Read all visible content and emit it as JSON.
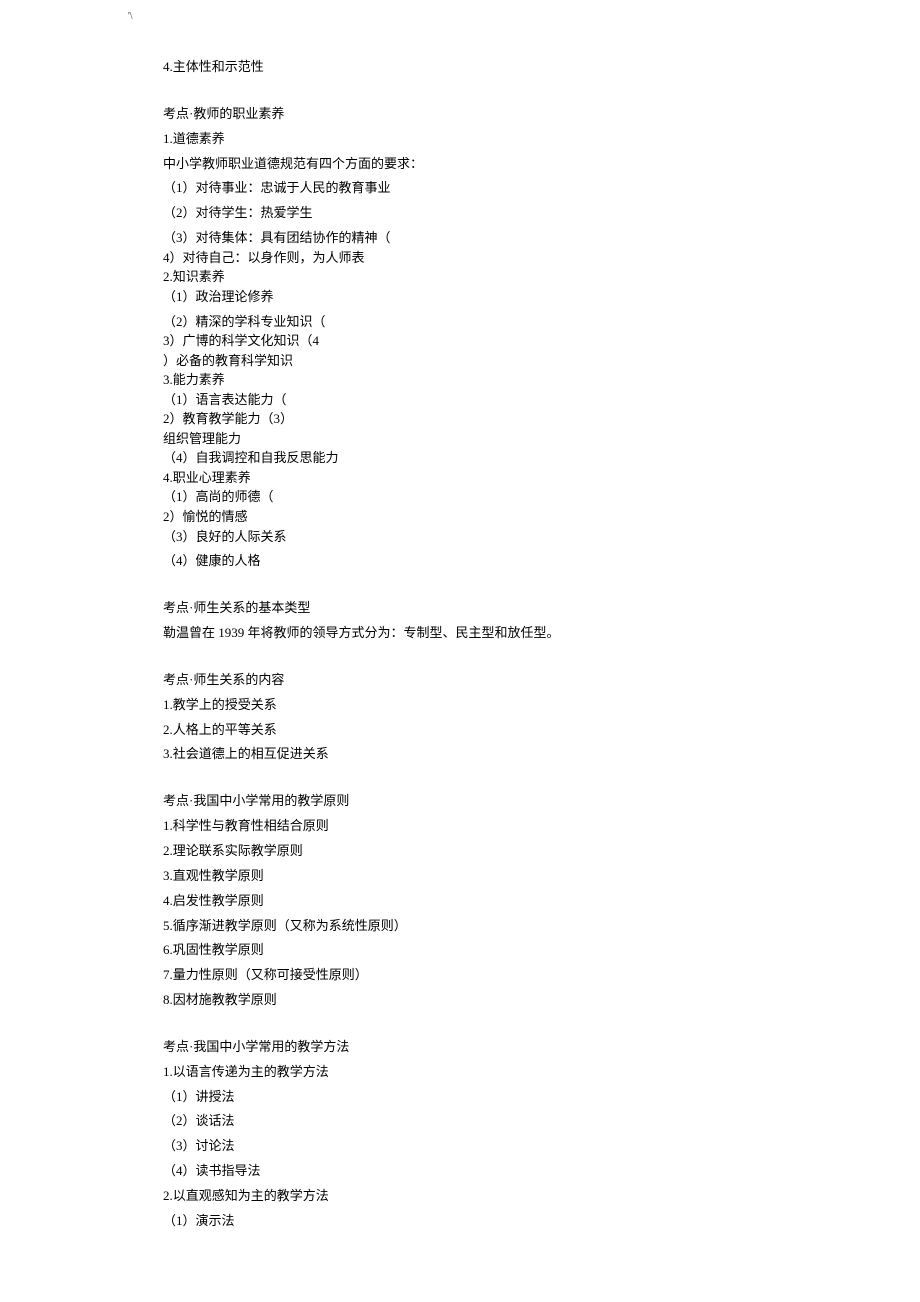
{
  "corner_mark": "'\\",
  "lines": {
    "l01": "4.主体性和示范性",
    "l02": "考点·教师的职业素养",
    "l03": "1.道德素养",
    "l04": "中小学教师职业道德规范有四个方面的要求：",
    "l05": "（1）对待事业：忠诚于人民的教育事业",
    "l06": "（2）对待学生：热爱学生",
    "l07": "（3）对待集体：具有团结协作的精神（",
    "l08": "4）对待自己：以身作则，为人师表",
    "l09": "2.知识素养",
    "l10": "（1）政治理论修养",
    "l11": "（2）精深的学科专业知识（",
    "l12": "3）广博的科学文化知识（4",
    "l13": "）必备的教育科学知识",
    "l14": "3.能力素养",
    "l15": "（1）语言表达能力（",
    "l16": "2）教育教学能力（3）",
    "l17": "组织管理能力",
    "l18": "（4）自我调控和自我反思能力",
    "l19": "4.职业心理素养",
    "l20": "（1）高尚的师德（",
    "l21": "2）愉悦的情感",
    "l22": "（3）良好的人际关系",
    "l23": "（4）健康的人格",
    "l24": "考点·师生关系的基本类型",
    "l25": "勒温曾在 1939 年将教师的领导方式分为：专制型、民主型和放任型。",
    "l26": "考点·师生关系的内容",
    "l27": "1.教学上的授受关系",
    "l28": "2.人格上的平等关系",
    "l29": "3.社会道德上的相互促进关系",
    "l30": "考点·我国中小学常用的教学原则",
    "l31": "1.科学性与教育性相结合原则",
    "l32": "2.理论联系实际教学原则",
    "l33": "3.直观性教学原则",
    "l34": "4.启发性教学原则",
    "l35": "5.循序渐进教学原则（又称为系统性原则）",
    "l36": "6.巩固性教学原则",
    "l37": "7.量力性原则（又称可接受性原则）",
    "l38": "8.因材施教教学原则",
    "l39": "考点·我国中小学常用的教学方法",
    "l40": "1.以语言传递为主的教学方法",
    "l41": "（1）讲授法",
    "l42": "（2）谈话法",
    "l43": "（3）讨论法",
    "l44": "（4）读书指导法",
    "l45": "2.以直观感知为主的教学方法",
    "l46": "（1）演示法"
  }
}
